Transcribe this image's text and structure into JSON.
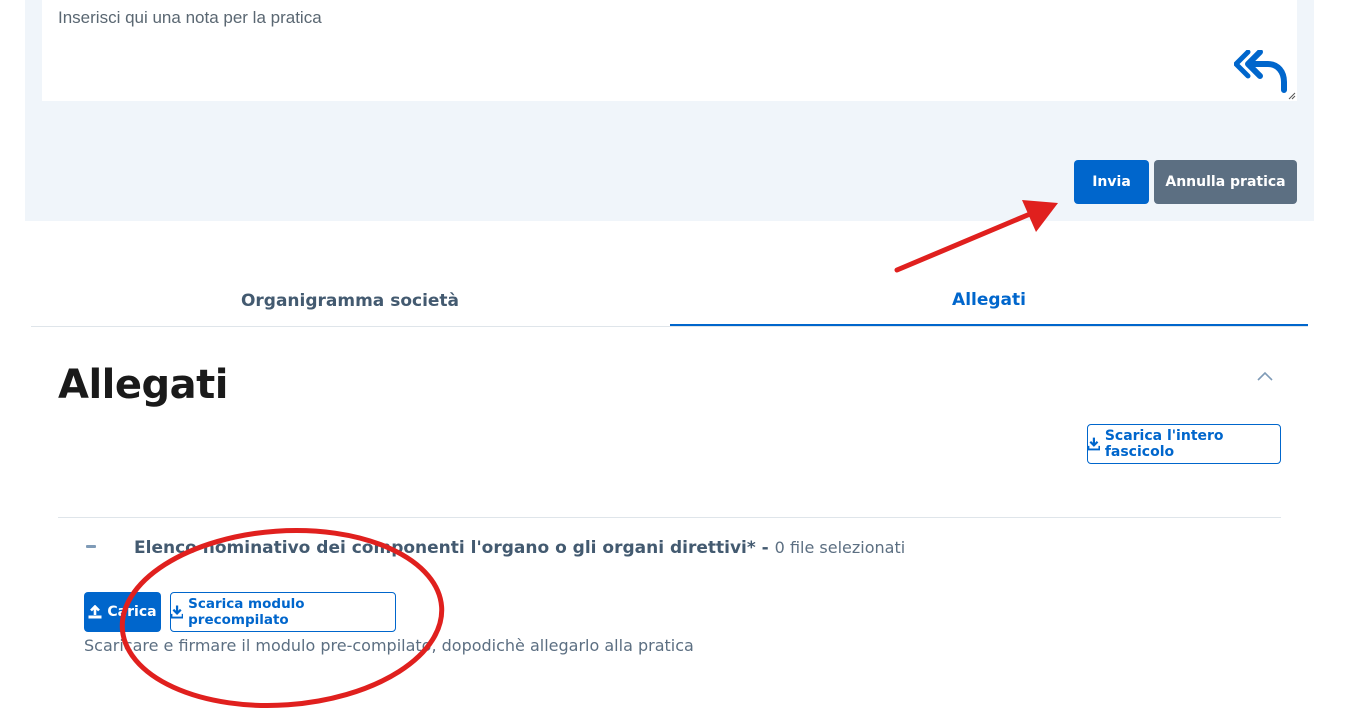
{
  "note": {
    "text": "Inserisci qui una nota per la pratica"
  },
  "actions": {
    "send_label": "Invia",
    "cancel_label": "Annulla pratica"
  },
  "tabs": [
    {
      "label": "Organigramma società",
      "active": false
    },
    {
      "label": "Allegati",
      "active": true
    }
  ],
  "section": {
    "title": "Allegati",
    "download_all_label": "Scarica l'intero fascicolo",
    "item": {
      "title": "Elenco nominativo dei componenti l'organo o gli organi direttivi*",
      "separator": " - ",
      "count_text": "0 file selezionati",
      "upload_label": "Carica",
      "download_module_label": "Scarica modulo precompilato",
      "hint": "Scaricare e firmare il modulo pre-compilato, dopodichè allegarlo alla pratica"
    }
  },
  "icons": {
    "reply": "reply-all-icon",
    "upload": "upload-icon",
    "download": "download-icon",
    "collapse": "chevron-up-icon"
  },
  "colors": {
    "accent": "#0066cc",
    "annotation": "#e0201e",
    "secondary": "#5c6f82",
    "panel": "#f0f5fa"
  }
}
